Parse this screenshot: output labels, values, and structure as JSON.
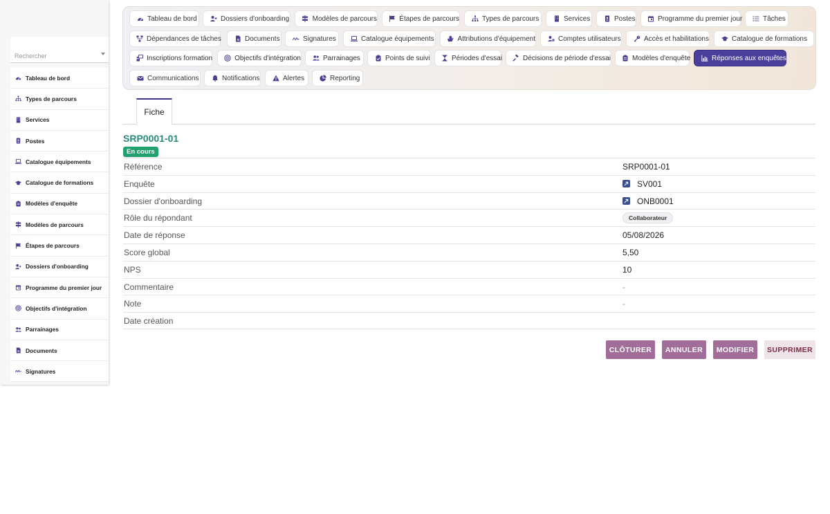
{
  "sidebar": {
    "search_placeholder": "Rechercher",
    "items": [
      {
        "label": "Tableau de bord",
        "icon": "dashboard-icon"
      },
      {
        "label": "Types de parcours",
        "icon": "sitemap-icon"
      },
      {
        "label": "Services",
        "icon": "building-icon"
      },
      {
        "label": "Postes",
        "icon": "badge-icon"
      },
      {
        "label": "Catalogue équipements",
        "icon": "laptop-icon"
      },
      {
        "label": "Catalogue de formations",
        "icon": "graduation-cap-icon"
      },
      {
        "label": "Modèles d'enquête",
        "icon": "clipboard-icon"
      },
      {
        "label": "Modèles de parcours",
        "icon": "signpost-icon"
      },
      {
        "label": "Étapes de parcours",
        "icon": "flag-icon"
      },
      {
        "label": "Dossiers d'onboarding",
        "icon": "user-plus-icon"
      },
      {
        "label": "Programme du premier jour",
        "icon": "calendar-icon"
      },
      {
        "label": "Objectifs d'intégration",
        "icon": "target-icon"
      },
      {
        "label": "Parrainages",
        "icon": "users-icon"
      },
      {
        "label": "Documents",
        "icon": "file-icon"
      },
      {
        "label": "Signatures",
        "icon": "signature-icon"
      }
    ]
  },
  "nav": {
    "items": [
      {
        "label": "Tableau de bord",
        "icon": "dashboard-icon",
        "active": false
      },
      {
        "label": "Dossiers d'onboarding",
        "icon": "user-plus-icon",
        "active": false
      },
      {
        "label": "Modèles de parcours",
        "icon": "signpost-icon",
        "active": false
      },
      {
        "label": "Étapes de parcours",
        "icon": "flag-icon",
        "active": false
      },
      {
        "label": "Types de parcours",
        "icon": "sitemap-icon",
        "active": false
      },
      {
        "label": "Services",
        "icon": "building-icon",
        "active": false
      },
      {
        "label": "Postes",
        "icon": "badge-icon",
        "active": false
      },
      {
        "label": "Programme du premier jour",
        "icon": "calendar-icon",
        "active": false
      },
      {
        "label": "Tâches",
        "icon": "list-icon",
        "active": false
      },
      {
        "label": "Dépendances de tâches",
        "icon": "diagram-icon",
        "active": false
      },
      {
        "label": "Documents",
        "icon": "file-icon",
        "active": false
      },
      {
        "label": "Signatures",
        "icon": "signature-icon",
        "active": false
      },
      {
        "label": "Catalogue équipements",
        "icon": "laptop-icon",
        "active": false
      },
      {
        "label": "Attributions d'équipement",
        "icon": "hand-icon",
        "active": false
      },
      {
        "label": "Comptes utilisateurs",
        "icon": "user-gear-icon",
        "active": false
      },
      {
        "label": "Accès et habilitations",
        "icon": "key-icon",
        "active": false
      },
      {
        "label": "Catalogue de formations",
        "icon": "graduation-cap-icon",
        "active": false
      },
      {
        "label": "Inscriptions formation",
        "icon": "person-chalkboard-icon",
        "active": false
      },
      {
        "label": "Objectifs d'intégration",
        "icon": "target-icon",
        "active": false
      },
      {
        "label": "Parrainages",
        "icon": "users-icon",
        "active": false
      },
      {
        "label": "Points de suivi",
        "icon": "clipboard-check-icon",
        "active": false
      },
      {
        "label": "Périodes d'essai",
        "icon": "hourglass-icon",
        "active": false
      },
      {
        "label": "Décisions de période d'essai",
        "icon": "gavel-icon",
        "active": false
      },
      {
        "label": "Modèles d'enquête",
        "icon": "clipboard-icon",
        "active": false
      },
      {
        "label": "Réponses aux enquêtes",
        "icon": "chart-icon",
        "active": true
      },
      {
        "label": "Communications",
        "icon": "envelope-icon",
        "active": false
      },
      {
        "label": "Notifications",
        "icon": "bell-icon",
        "active": false
      },
      {
        "label": "Alertes",
        "icon": "warning-icon",
        "active": false
      },
      {
        "label": "Reporting",
        "icon": "pie-chart-icon",
        "active": false
      }
    ]
  },
  "tabs": {
    "fiche": "Fiche"
  },
  "record": {
    "title": "SRP0001-01",
    "status": "En cours",
    "fields": [
      {
        "label": "Référence",
        "value": "SRP0001-01",
        "kind": "text"
      },
      {
        "label": "Enquête",
        "value": "SV001",
        "kind": "link"
      },
      {
        "label": "Dossier d'onboarding",
        "value": "ONB0001",
        "kind": "link"
      },
      {
        "label": "Rôle du répondant",
        "value": "Collaborateur",
        "kind": "chip"
      },
      {
        "label": "Date de réponse",
        "value": "05/08/2026",
        "kind": "text"
      },
      {
        "label": "Score global",
        "value": "5,50",
        "kind": "text"
      },
      {
        "label": "NPS",
        "value": "10",
        "kind": "text"
      },
      {
        "label": "Commentaire",
        "value": "-",
        "kind": "dash"
      },
      {
        "label": "Note",
        "value": "-",
        "kind": "dash"
      },
      {
        "label": "Date création",
        "value": "",
        "kind": "text"
      }
    ]
  },
  "actions": {
    "close": "CLÔTURER",
    "cancel": "ANNULER",
    "edit": "MODIFIER",
    "delete": "SUPPRIMER"
  },
  "colors": {
    "accent": "#4b3f9c",
    "title": "#2a8a7a",
    "status": "#23a070",
    "primary_button": "#a06e98",
    "danger_button_text": "#7b2d3f"
  }
}
